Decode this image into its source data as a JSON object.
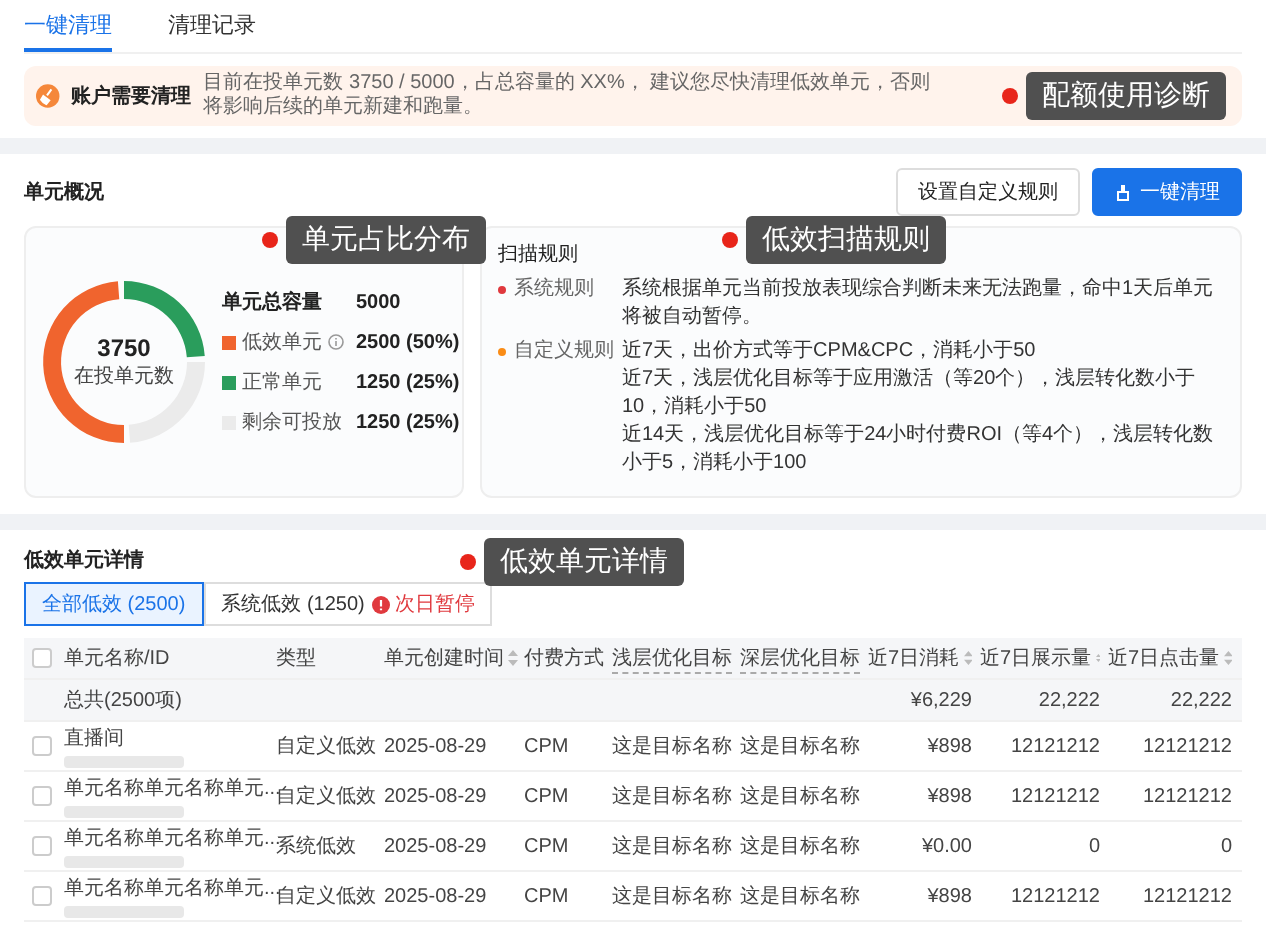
{
  "tabs": [
    {
      "label": "一键清理",
      "selected": true
    },
    {
      "label": "清理记录",
      "selected": false
    }
  ],
  "banner": {
    "title": "账户需要清理",
    "message": "目前在投单元数 3750 / 5000，占总容量的 XX%， 建议您尽快清理低效单元，否则将影响后续的单元新建和跑量。",
    "callout": "配额使用诊断"
  },
  "overview": {
    "title": "单元概况",
    "buttons": [
      {
        "label": "设置自定义规则",
        "kind": "secondary"
      },
      {
        "label": "一键清理",
        "kind": "primary"
      }
    ],
    "donut": {
      "value": "3750",
      "caption": "在投单元数",
      "callout": "单元占比分布",
      "chart_data": {
        "type": "donut",
        "categories": [
          "低效单元",
          "正常单元",
          "剩余可投放"
        ],
        "values": [
          50,
          25,
          25
        ]
      }
    },
    "capacity": {
      "label": "单元总容量",
      "value": "5000"
    },
    "legend": [
      {
        "value": "2500 (50%)",
        "color": "#f0642e",
        "info": true
      },
      {
        "value": "1250 (25%)",
        "color": "#2a9d5c",
        "info": false
      },
      {
        "value": "1250 (25%)",
        "color": "#ebebeb",
        "info": false
      }
    ],
    "rules": {
      "title": "扫描规则",
      "callout": "低效扫描规则",
      "groups": [
        {
          "label": "系统规则",
          "color": "#e0393e",
          "lines": [
            "系统根据单元当前投放表现综合判断未来无法跑量，命中1天后单元将被自动暂停。"
          ]
        },
        {
          "label": "自定义规则",
          "color": "#fa8c16",
          "lines": [
            "近7天，出价方式等于CPM&CPC，消耗小于50",
            "近7天，浅层优化目标等于应用激活（等20个），浅层转化数小于10，消耗小于50",
            "近14天，浅层优化目标等于24小时付费ROI（等4个），浅层转化数小于5，消耗小于100"
          ]
        }
      ]
    }
  },
  "details": {
    "title": "低效单元详情",
    "callout": "低效单元详情",
    "filters": [
      {
        "label": "全部低效 (2500)",
        "selected": true
      },
      {
        "label": "系统低效 (1250)",
        "selected": false,
        "badge": "次日暂停"
      }
    ],
    "select_all_checked": false,
    "columns": [
      {
        "label": "单元名称/ID",
        "sortable": false,
        "hint": false
      },
      {
        "label": "类型",
        "sortable": false,
        "hint": false
      },
      {
        "label": "单元创建时间",
        "sortable": true,
        "hint": false
      },
      {
        "label": "付费方式",
        "sortable": false,
        "hint": false
      },
      {
        "label": "浅层优化目标",
        "sortable": false,
        "hint": true
      },
      {
        "label": "深层优化目标",
        "sortable": false,
        "hint": true
      },
      {
        "label": "近7日消耗",
        "sortable": true,
        "hint": false
      },
      {
        "label": "近7日展示量",
        "sortable": true,
        "hint": false
      },
      {
        "label": "近7日点击量",
        "sortable": true,
        "hint": false
      }
    ],
    "total": {
      "label": "总共(2500项)",
      "values": [
        "¥6,229",
        "22,222",
        "22,222"
      ]
    },
    "rows": [
      {
        "checked": false,
        "cells": [
          "直播间",
          "自定义低效",
          "2025-08-29",
          "CPM",
          "这是目标名称",
          "这是目标名称",
          "¥898",
          "12121212",
          "12121212"
        ]
      },
      {
        "checked": false,
        "cells": [
          "单元名称单元名称单元...",
          "自定义低效",
          "2025-08-29",
          "CPM",
          "这是目标名称",
          "这是目标名称",
          "¥898",
          "12121212",
          "12121212"
        ]
      },
      {
        "checked": false,
        "cells": [
          "单元名称单元名称单元...",
          "系统低效",
          "2025-08-29",
          "CPM",
          "这是目标名称",
          "这是目标名称",
          "¥0.00",
          "0",
          "0"
        ]
      },
      {
        "checked": false,
        "cells": [
          "单元名称单元名称单元...",
          "自定义低效",
          "2025-08-29",
          "CPM",
          "这是目标名称",
          "这是目标名称",
          "¥898",
          "12121212",
          "12121212"
        ]
      }
    ]
  }
}
